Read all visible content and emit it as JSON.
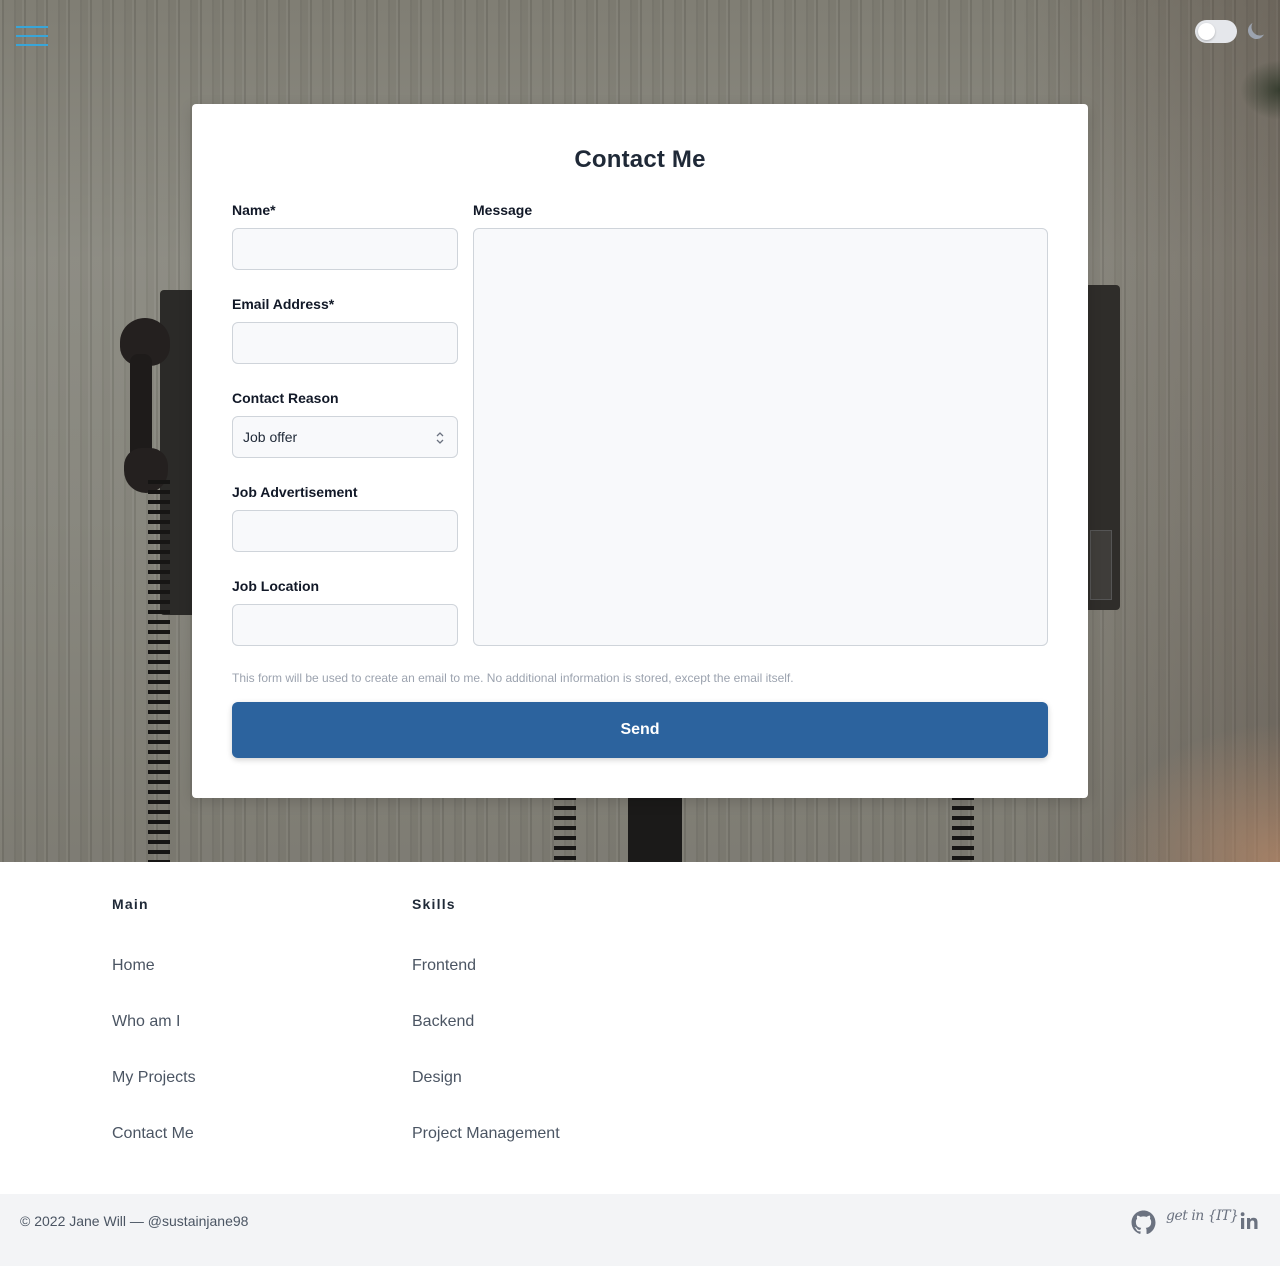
{
  "header": {
    "menu_icon": "hamburger-menu-icon",
    "theme_toggle_icon": "moon-icon"
  },
  "form": {
    "title": "Contact Me",
    "name_label": "Name*",
    "name_value": "",
    "email_label": "Email Address*",
    "email_value": "",
    "reason_label": "Contact Reason",
    "reason_value": "Job offer",
    "job_ad_label": "Job Advertisement",
    "job_ad_value": "",
    "job_location_label": "Job Location",
    "job_location_value": "",
    "message_label": "Message",
    "message_value": "",
    "privacy_note": "This form will be used to create an email to me. No additional information is stored, except the email itself.",
    "send_label": "Send",
    "accent_color": "#2c639e"
  },
  "footer": {
    "main": {
      "heading": "Main",
      "links": [
        "Home",
        "Who am I",
        "My Projects",
        "Contact Me"
      ]
    },
    "skills": {
      "heading": "Skills",
      "links": [
        "Frontend",
        "Backend",
        "Design",
        "Project Management"
      ]
    },
    "copyright": "© 2022 Jane Will — @sustainjane98",
    "social": {
      "github_icon": "github-icon",
      "getin_logo": "get in {IT}",
      "linkedin_icon": "linkedin-icon"
    }
  }
}
